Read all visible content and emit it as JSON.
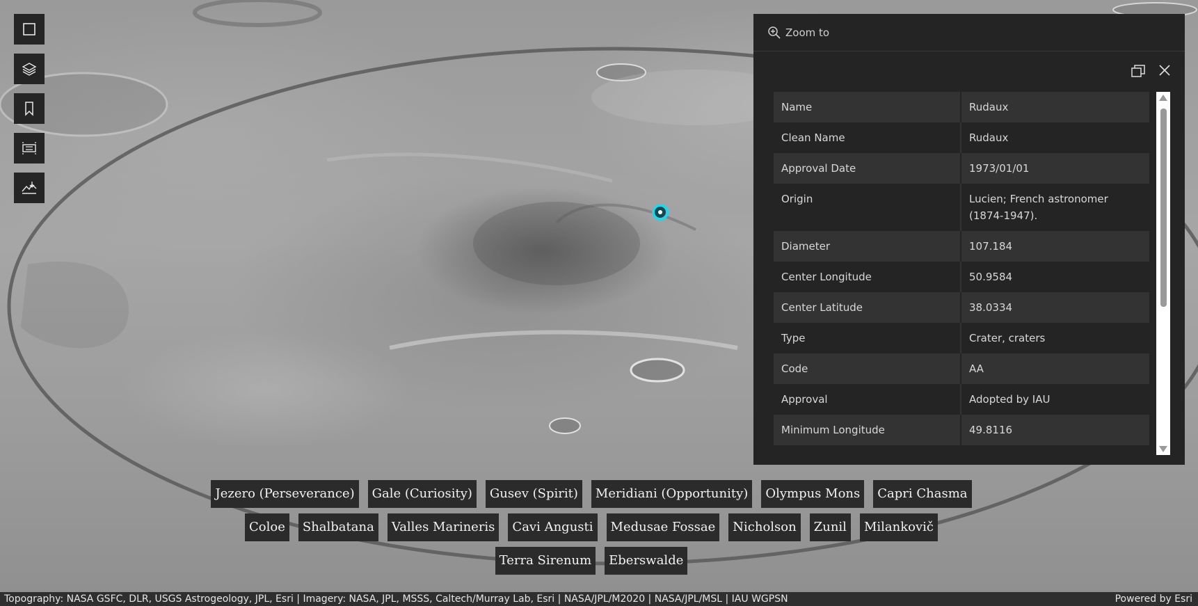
{
  "toolbar": {
    "buttons": [
      {
        "icon": "square-icon"
      },
      {
        "icon": "layers-icon"
      },
      {
        "icon": "bookmark-icon"
      },
      {
        "icon": "measure-icon"
      },
      {
        "icon": "elevation-profile-icon"
      }
    ]
  },
  "popup": {
    "zoom_to_label": "Zoom to",
    "attributes": [
      {
        "key": "Name",
        "value": "Rudaux"
      },
      {
        "key": "Clean Name",
        "value": "Rudaux"
      },
      {
        "key": "Approval Date",
        "value": "1973/01/01"
      },
      {
        "key": "Origin",
        "value": "Lucien; French astronomer (1874-1947)."
      },
      {
        "key": "Diameter",
        "value": "107.184"
      },
      {
        "key": "Center Longitude",
        "value": "50.9584"
      },
      {
        "key": "Center Latitude",
        "value": "38.0334"
      },
      {
        "key": "Type",
        "value": "Crater, craters"
      },
      {
        "key": "Code",
        "value": "AA"
      },
      {
        "key": "Approval",
        "value": "Adopted by IAU"
      },
      {
        "key": "Minimum Longitude",
        "value": "49.8116"
      }
    ]
  },
  "bookmarks": {
    "row1": [
      "Jezero (Perseverance)",
      "Gale (Curiosity)",
      "Gusev (Spirit)",
      "Meridiani (Opportunity)",
      "Olympus Mons",
      "Capri Chasma"
    ],
    "row2": [
      "Coloe",
      "Shalbatana",
      "Valles Marineris",
      "Cavi Angusti",
      "Medusae Fossae",
      "Nicholson",
      "Zunil",
      "Milankovič"
    ],
    "row3": [
      "Terra Sirenum",
      "Eberswalde"
    ]
  },
  "attribution": {
    "left": "Topography: NASA GSFC, DLR, USGS Astrogeology, JPL, Esri | Imagery: NASA, JPL, MSSS, Caltech/Murray Lab, Esri | NASA/JPL/M2020 | NASA/JPL/MSL | IAU WGPSN",
    "right": "Powered by Esri"
  },
  "colors": {
    "marker": "#29d3e6",
    "panel": "#242424",
    "row_alt": "#333333"
  }
}
